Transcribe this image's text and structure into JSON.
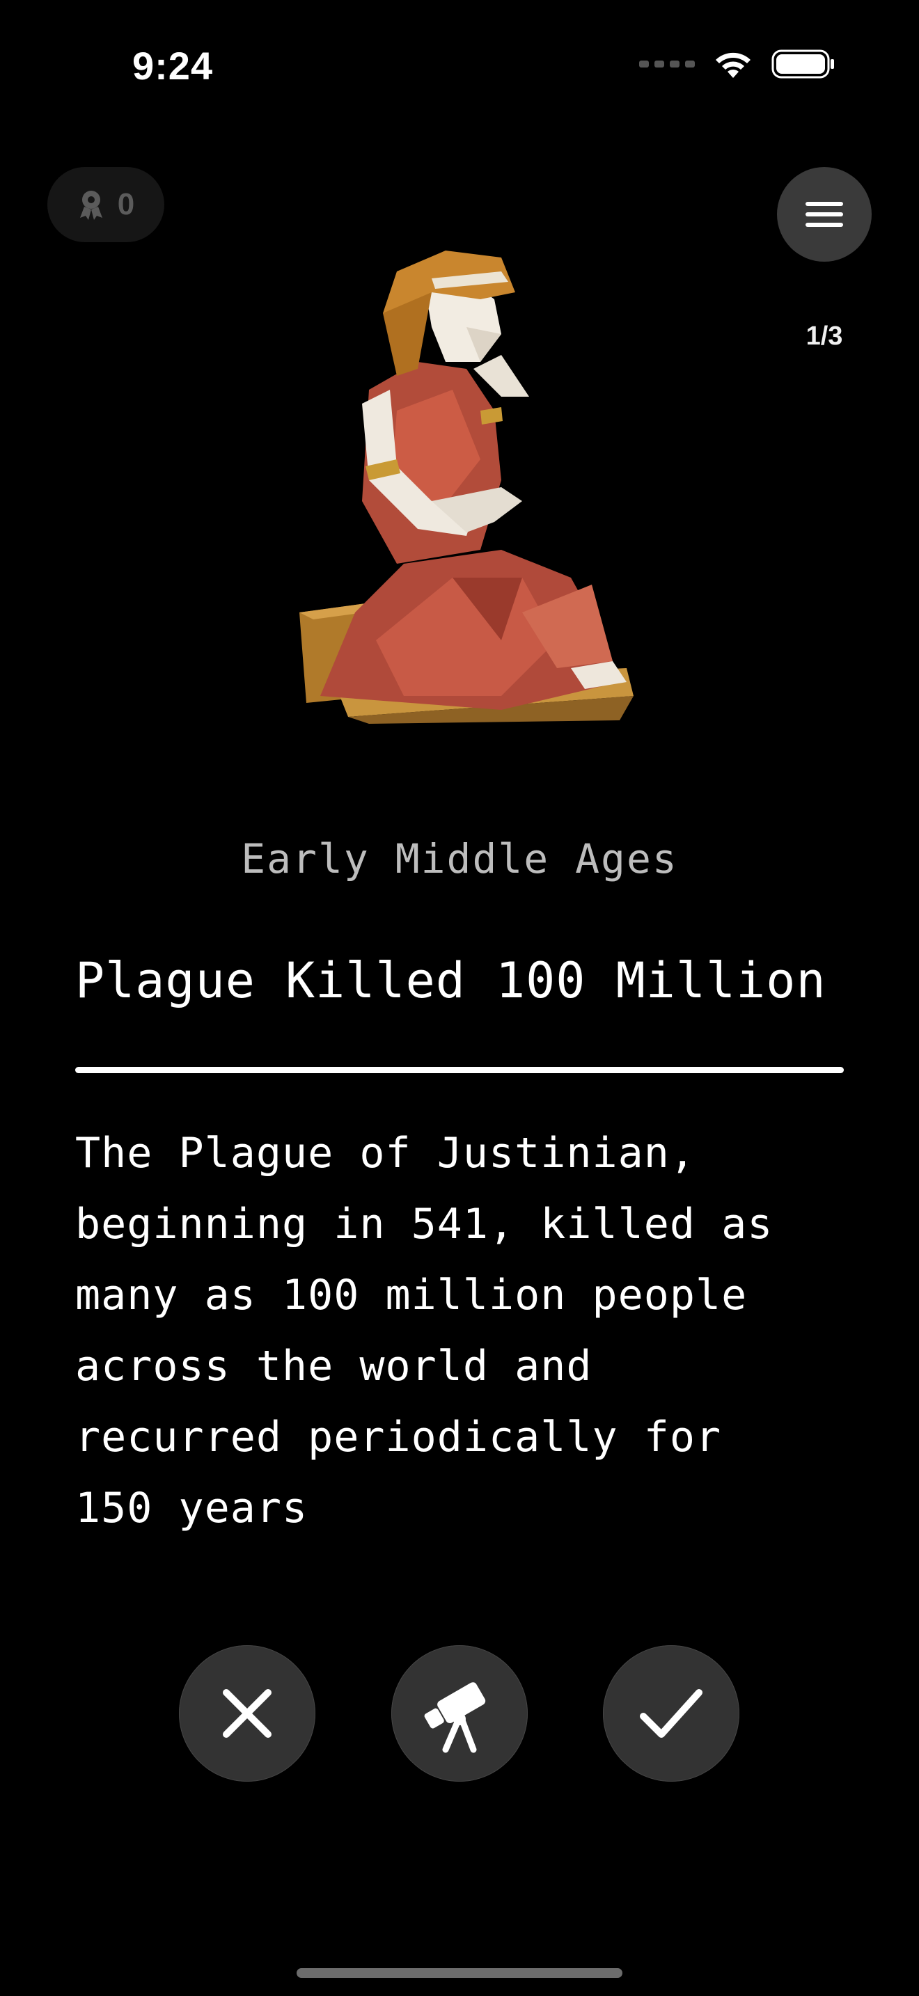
{
  "status_bar": {
    "time": "9:24"
  },
  "award": {
    "count": "0",
    "icon": "award-ribbon-icon"
  },
  "menu": {
    "icon": "hamburger-menu-icon",
    "page_counter": "1/3"
  },
  "card": {
    "illustration": "low-poly statue of a seated woman in a red robe",
    "era": "Early Middle Ages",
    "title": "Plague Killed 100 Million",
    "body_lines": [
      "The Plague of Justinian,",
      "beginning in 541, killed as",
      "many as 100 million people",
      "across the world and",
      "recurred periodically for",
      "150 years"
    ]
  },
  "actions": [
    {
      "name": "dismiss",
      "icon": "close-icon"
    },
    {
      "name": "explore",
      "icon": "telescope-icon"
    },
    {
      "name": "confirm",
      "icon": "checkmark-icon"
    }
  ],
  "colors": {
    "background": "#000000",
    "button": "#333333",
    "pill": "#161616",
    "muted_text": "#bdbdbd"
  }
}
